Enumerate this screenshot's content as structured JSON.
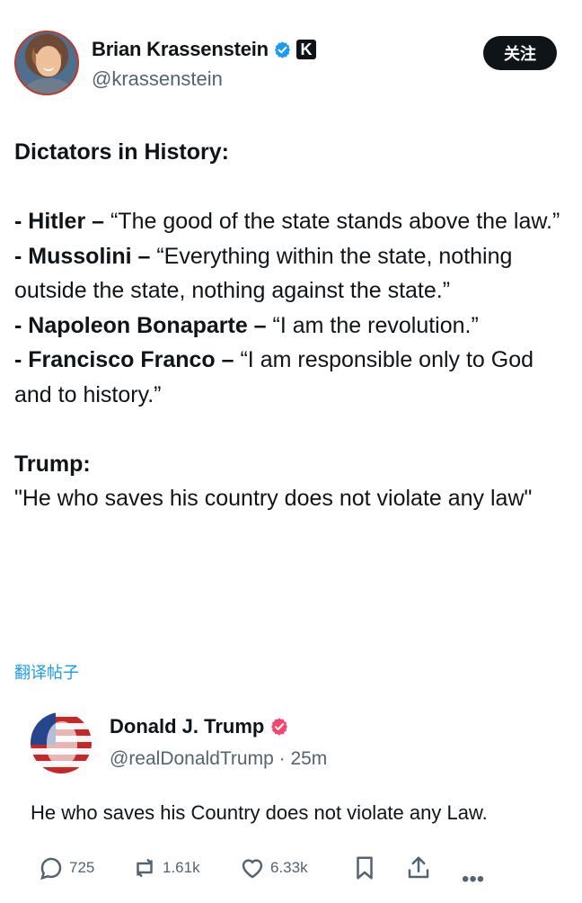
{
  "author": {
    "name": "Brian Krassenstein",
    "handle": "@krassenstein",
    "affiliation_badge": "K",
    "follow_label": "关注"
  },
  "post": {
    "heading": "Dictators in History:",
    "items": [
      {
        "leader": "- Hitler –",
        "quote": " “The good of the state stands above the law.”"
      },
      {
        "leader": "- Mussolini –",
        "quote": " “Everything within the state, nothing outside the state, nothing against the state.”"
      },
      {
        "leader": "- Napoleon Bonaparte –",
        "quote": " “I am the revolution.”"
      },
      {
        "leader": "- Francisco Franco –",
        "quote": " “I am responsible only to God and to history.”"
      }
    ],
    "trump_label": "Trump:",
    "trump_quote": "\"He who saves his country does not violate any law\""
  },
  "translate_label": "翻译帖子",
  "quoted_post": {
    "name": "Donald J. Trump",
    "handle_time": "@realDonaldTrump · 25m",
    "text": "He who saves his Country does not violate any Law."
  },
  "actions": {
    "replies": "725",
    "reposts": "1.61k",
    "likes": "6.33k",
    "more": "•••"
  },
  "colors": {
    "verified": "#1d9bf0",
    "link": "#1d9bf0",
    "muted": "#536471",
    "truth_badge": "#f5456d"
  }
}
